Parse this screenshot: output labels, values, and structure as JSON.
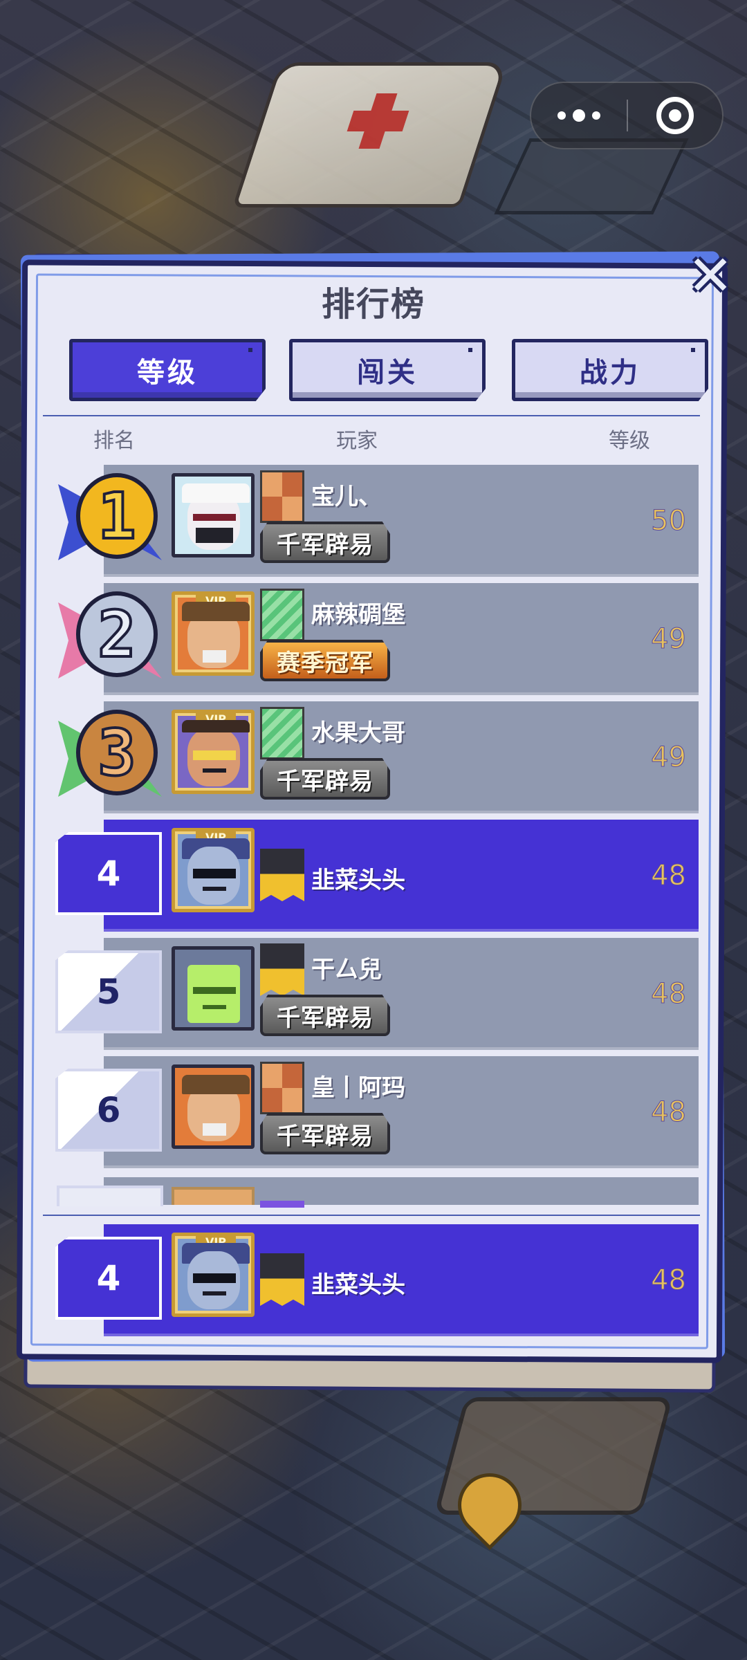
{
  "header": {
    "title": "排行榜",
    "close_icon": "close-x-icon"
  },
  "capsule": {
    "more_icon": "more-dots-icon",
    "exit_icon": "target-circle-icon"
  },
  "tabs": [
    {
      "label": "等级",
      "active": true
    },
    {
      "label": "闯关",
      "active": false
    },
    {
      "label": "战力",
      "active": false
    }
  ],
  "columns": {
    "rank": "排名",
    "player": "玩家",
    "level": "等级"
  },
  "rows": [
    {
      "rank": "1",
      "name": "宝儿、",
      "badge": "千军辟易",
      "level": "50",
      "vip": false
    },
    {
      "rank": "2",
      "name": "麻辣碉堡",
      "badge": "赛季冠军",
      "level": "49",
      "vip": true
    },
    {
      "rank": "3",
      "name": "水果大哥",
      "badge": "千军辟易",
      "level": "49",
      "vip": true
    },
    {
      "rank": "4",
      "name": "韭菜头头",
      "badge": "",
      "level": "48",
      "vip": true
    },
    {
      "rank": "5",
      "name": "干厶兒",
      "badge": "千军辟易",
      "level": "48",
      "vip": false
    },
    {
      "rank": "6",
      "name": "皇丨阿玛",
      "badge": "千军辟易",
      "level": "48",
      "vip": false
    }
  ],
  "my_rank": {
    "rank": "4",
    "name": "韭菜头头",
    "level": "48",
    "vip": true
  },
  "vip_label": "VIP",
  "colors": {
    "active_tab": "#4c3fd8",
    "inactive_tab": "#d8d9f3",
    "row_bg": "#9099b0",
    "highlight_row": "#4532d4",
    "level_text": "#e7c25e",
    "panel_bg": "#e8e9f6"
  }
}
